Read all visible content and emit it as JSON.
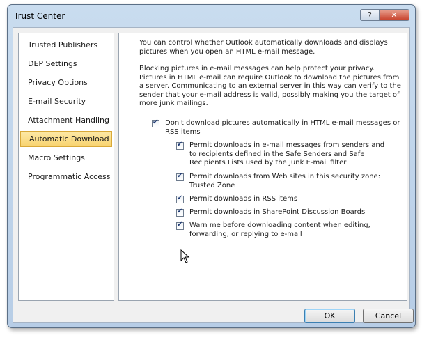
{
  "window": {
    "title": "Trust Center",
    "help_label": "?",
    "close_label": "✕"
  },
  "sidebar": {
    "items": [
      {
        "label": "Trusted Publishers",
        "selected": false
      },
      {
        "label": "DEP Settings",
        "selected": false
      },
      {
        "label": "Privacy Options",
        "selected": false
      },
      {
        "label": "E-mail Security",
        "selected": false
      },
      {
        "label": "Attachment Handling",
        "selected": false
      },
      {
        "label": "Automatic Download",
        "selected": true
      },
      {
        "label": "Macro Settings",
        "selected": false
      },
      {
        "label": "Programmatic Access",
        "selected": false
      }
    ]
  },
  "content": {
    "intro": "You can control whether Outlook automatically downloads and displays pictures when you open an HTML e-mail message.",
    "blocking": "Blocking pictures in e-mail messages can help protect your privacy. Pictures in HTML e-mail can require Outlook to download the pictures from a server. Communicating to an external server in this way can verify to the sender that your e-mail address is valid, possibly making you the target of more junk mailings.",
    "checkboxes": [
      {
        "label": "Don't download pictures automatically in HTML e-mail messages or RSS items",
        "checked": true
      },
      {
        "label": "Permit downloads in e-mail messages from senders and to recipients defined in the Safe Senders and Safe Recipients Lists used by the Junk E-mail filter",
        "checked": true
      },
      {
        "label": "Permit downloads from Web sites in this security zone: Trusted Zone",
        "checked": true
      },
      {
        "label": "Permit downloads in RSS items",
        "checked": true
      },
      {
        "label": "Permit downloads in SharePoint Discussion Boards",
        "checked": true
      },
      {
        "label": "Warn me before downloading content when editing, forwarding, or replying to e-mail",
        "checked": true
      }
    ]
  },
  "buttons": {
    "ok": "OK",
    "cancel": "Cancel"
  },
  "colors": {
    "selected_bg": "#f8d370",
    "close_button": "#c7402a",
    "checkmark": "#1f3a73"
  }
}
